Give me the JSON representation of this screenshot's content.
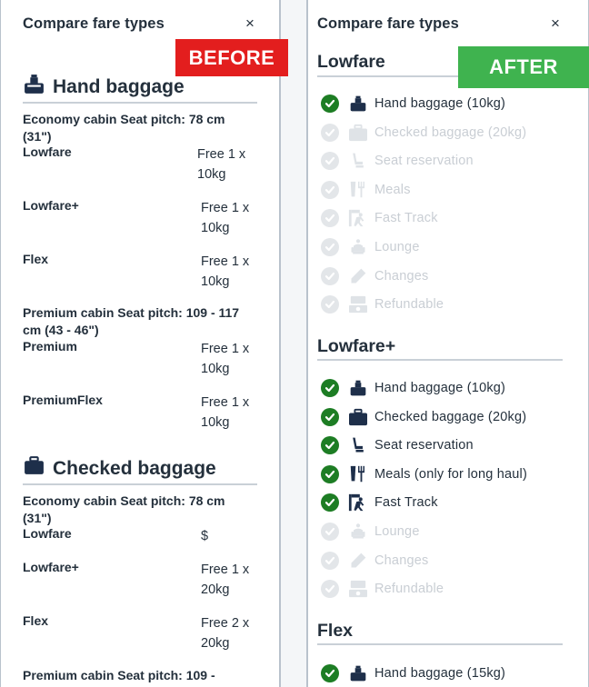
{
  "labels": {
    "before": "BEFORE",
    "after": "AFTER"
  },
  "before": {
    "title": "Compare fare types",
    "close": "×",
    "sections": [
      {
        "title": "Hand baggage",
        "icon": "cabin-bag-icon",
        "cabins": [
          {
            "label": "Economy cabin Seat pitch: 78 cm (31\")",
            "fares": [
              {
                "name": "Lowfare",
                "value": "Free 1 x 10kg"
              },
              {
                "name": "Lowfare+",
                "value": "Free 1 x 10kg"
              },
              {
                "name": "Flex",
                "value": "Free 1 x 10kg"
              }
            ]
          },
          {
            "label": "Premium cabin Seat pitch: 109 - 117 cm (43 - 46\")",
            "fares": [
              {
                "name": "Premium",
                "value": "Free 1 x 10kg"
              },
              {
                "name": "PremiumFlex",
                "value": "Free 1 x 10kg"
              }
            ]
          }
        ]
      },
      {
        "title": "Checked baggage",
        "icon": "suitcase-icon",
        "cabins": [
          {
            "label": "Economy cabin Seat pitch: 78 cm (31\")",
            "fares": [
              {
                "name": "Lowfare",
                "value": "$"
              },
              {
                "name": "Lowfare+",
                "value": "Free 1 x 20kg"
              },
              {
                "name": "Flex",
                "value": "Free 2 x 20kg"
              }
            ]
          },
          {
            "label": "Premium cabin Seat pitch: 109 -"
          }
        ]
      }
    ]
  },
  "after": {
    "title": "Compare fare types",
    "close": "×",
    "fares": [
      {
        "name": "Lowfare",
        "features": [
          {
            "label": "Hand baggage (10kg)",
            "included": true,
            "icon": "cabin-bag-icon"
          },
          {
            "label": "Checked baggage (20kg)",
            "included": false,
            "icon": "suitcase-icon"
          },
          {
            "label": "Seat reservation",
            "included": false,
            "icon": "seat-icon"
          },
          {
            "label": "Meals",
            "included": false,
            "icon": "meal-icon"
          },
          {
            "label": "Fast Track",
            "included": false,
            "icon": "fast-track-icon"
          },
          {
            "label": "Lounge",
            "included": false,
            "icon": "lounge-icon"
          },
          {
            "label": "Changes",
            "included": false,
            "icon": "pencil-icon"
          },
          {
            "label": "Refundable",
            "included": false,
            "icon": "refund-icon"
          }
        ]
      },
      {
        "name": "Lowfare+",
        "features": [
          {
            "label": "Hand baggage (10kg)",
            "included": true,
            "icon": "cabin-bag-icon"
          },
          {
            "label": "Checked baggage (20kg)",
            "included": true,
            "icon": "suitcase-icon"
          },
          {
            "label": "Seat reservation",
            "included": true,
            "icon": "seat-icon"
          },
          {
            "label": "Meals (only for long haul)",
            "included": true,
            "icon": "meal-icon"
          },
          {
            "label": "Fast Track",
            "included": true,
            "icon": "fast-track-icon"
          },
          {
            "label": "Lounge",
            "included": false,
            "icon": "lounge-icon"
          },
          {
            "label": "Changes",
            "included": false,
            "icon": "pencil-icon"
          },
          {
            "label": "Refundable",
            "included": false,
            "icon": "refund-icon"
          }
        ]
      },
      {
        "name": "Flex",
        "features": [
          {
            "label": "Hand baggage (15kg)",
            "included": true,
            "icon": "cabin-bag-icon"
          }
        ]
      }
    ]
  },
  "colors": {
    "text": "#24303c",
    "included": "#1d7d24",
    "excluded_text": "#c9ced4",
    "before_tag": "#e31e1e",
    "after_tag": "#3fb34f"
  }
}
